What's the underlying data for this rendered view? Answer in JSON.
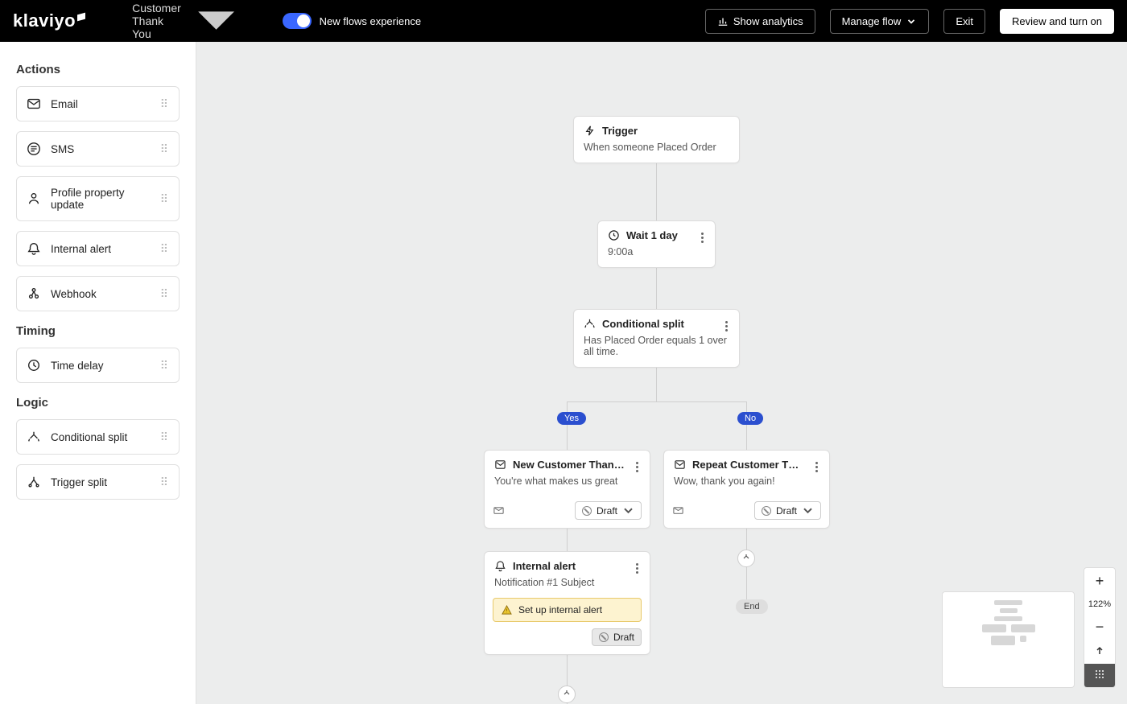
{
  "header": {
    "logo": "klaviyo",
    "flow_name": "Customer Thank You",
    "toggle_label": "New flows experience",
    "show_analytics": "Show analytics",
    "manage_flow": "Manage flow",
    "exit": "Exit",
    "review": "Review and turn on"
  },
  "sidebar": {
    "sections": {
      "actions_title": "Actions",
      "timing_title": "Timing",
      "logic_title": "Logic"
    },
    "actions": [
      {
        "label": "Email"
      },
      {
        "label": "SMS"
      },
      {
        "label": "Profile property update"
      },
      {
        "label": "Internal alert"
      },
      {
        "label": "Webhook"
      }
    ],
    "timing": [
      {
        "label": "Time delay"
      }
    ],
    "logic": [
      {
        "label": "Conditional split"
      },
      {
        "label": "Trigger split"
      }
    ]
  },
  "canvas": {
    "trigger": {
      "title": "Trigger",
      "desc": "When someone Placed Order"
    },
    "wait": {
      "title": "Wait 1 day",
      "desc": "9:00a"
    },
    "split": {
      "title": "Conditional split",
      "desc": "Has Placed Order equals 1 over all time."
    },
    "yes": "Yes",
    "no": "No",
    "email_new": {
      "title": "New Customer Thank You: Em…",
      "desc": "You're what makes us great",
      "status": "Draft"
    },
    "email_repeat": {
      "title": "Repeat Customer Thank You:…",
      "desc": "Wow, thank you again!",
      "status": "Draft"
    },
    "alert": {
      "title": "Internal alert",
      "desc": "Notification #1 Subject",
      "warning": "Set up internal alert",
      "status": "Draft"
    },
    "end": "End"
  },
  "zoom": {
    "in": "+",
    "level": "122%",
    "out": "−"
  }
}
